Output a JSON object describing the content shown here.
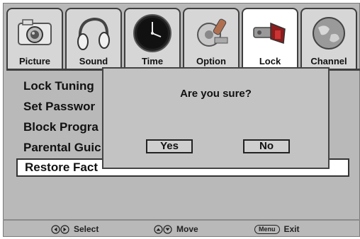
{
  "tabs": [
    {
      "label": "Picture",
      "icon": "camera-icon"
    },
    {
      "label": "Sound",
      "icon": "headphones-icon"
    },
    {
      "label": "Time",
      "icon": "clock-icon"
    },
    {
      "label": "Option",
      "icon": "gear-icon"
    },
    {
      "label": "Lock",
      "icon": "lock-icon",
      "active": true
    },
    {
      "label": "Channel",
      "icon": "globe-icon"
    }
  ],
  "menu": {
    "items": [
      "Lock Tuning",
      "Set Passwor",
      "Block Progra",
      "Parental Guic",
      "Restore Fact"
    ],
    "selected_index": 4
  },
  "dialog": {
    "question": "Are you sure?",
    "yes_label": "Yes",
    "no_label": "No"
  },
  "footer": {
    "select_label": "Select",
    "move_label": "Move",
    "menu_key": "Menu",
    "exit_label": "Exit"
  },
  "colors": {
    "panel_bg": "#b9b9b9",
    "active_tab_bg": "#ffffff",
    "dialog_bg": "#c3c3c3"
  }
}
